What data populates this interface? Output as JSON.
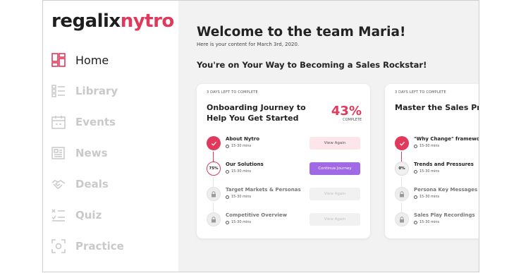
{
  "logo": {
    "part1": "regalix",
    "part2": "nytro"
  },
  "nav": [
    {
      "label": "Home",
      "icon": "home-icon",
      "active": true
    },
    {
      "label": "Library",
      "icon": "library-icon",
      "active": false
    },
    {
      "label": "Events",
      "icon": "calendar-icon",
      "active": false
    },
    {
      "label": "News",
      "icon": "news-icon",
      "active": false
    },
    {
      "label": "Deals",
      "icon": "handshake-icon",
      "active": false
    },
    {
      "label": "Quiz",
      "icon": "quiz-icon",
      "active": false
    },
    {
      "label": "Practice",
      "icon": "practice-icon",
      "active": false
    }
  ],
  "header": {
    "title": "Welcome to the team Maria!",
    "subtitle": "Here is your content for March 3rd, 2020.",
    "section": "You're on Your Way to Becoming a Sales Rockstar!"
  },
  "colors": {
    "accent": "#e0395c",
    "purple": "#a06ae6"
  },
  "cards": [
    {
      "days_left": "3 DAYS LEFT TO COMPLETE",
      "title": "Onboarding Journey to Help You Get Started",
      "percent": "43%",
      "percent_label": "COMPLETE",
      "steps": [
        {
          "name": "About Nytro",
          "time": "15-30 mins",
          "state": "done",
          "badge": "",
          "button": "View Again"
        },
        {
          "name": "Our Solutions",
          "time": "15-30 mins",
          "state": "progress",
          "badge": "75%",
          "button": "Continue Journey"
        },
        {
          "name": "Target Markets & Personas",
          "time": "15-30 mins",
          "state": "locked",
          "badge": "",
          "button": "View Again"
        },
        {
          "name": "Competitive Overview",
          "time": "15-30 mins",
          "state": "locked",
          "badge": "",
          "button": "View Again"
        }
      ]
    },
    {
      "days_left": "3 DAYS LEFT TO COMPLETE",
      "title": "Master the Sales Proce",
      "steps": [
        {
          "name": "\"Why Change\" framework",
          "time": "15-30 mins",
          "state": "done",
          "badge": ""
        },
        {
          "name": "Trends and Pressures",
          "time": "15-30 mins",
          "state": "zero",
          "badge": "0%"
        },
        {
          "name": "Persona Key Messages & Stories",
          "time": "15-30 mins",
          "state": "locked",
          "badge": ""
        },
        {
          "name": "Sales Play Recordings",
          "time": "15-30 mins",
          "state": "locked",
          "badge": ""
        }
      ]
    }
  ]
}
